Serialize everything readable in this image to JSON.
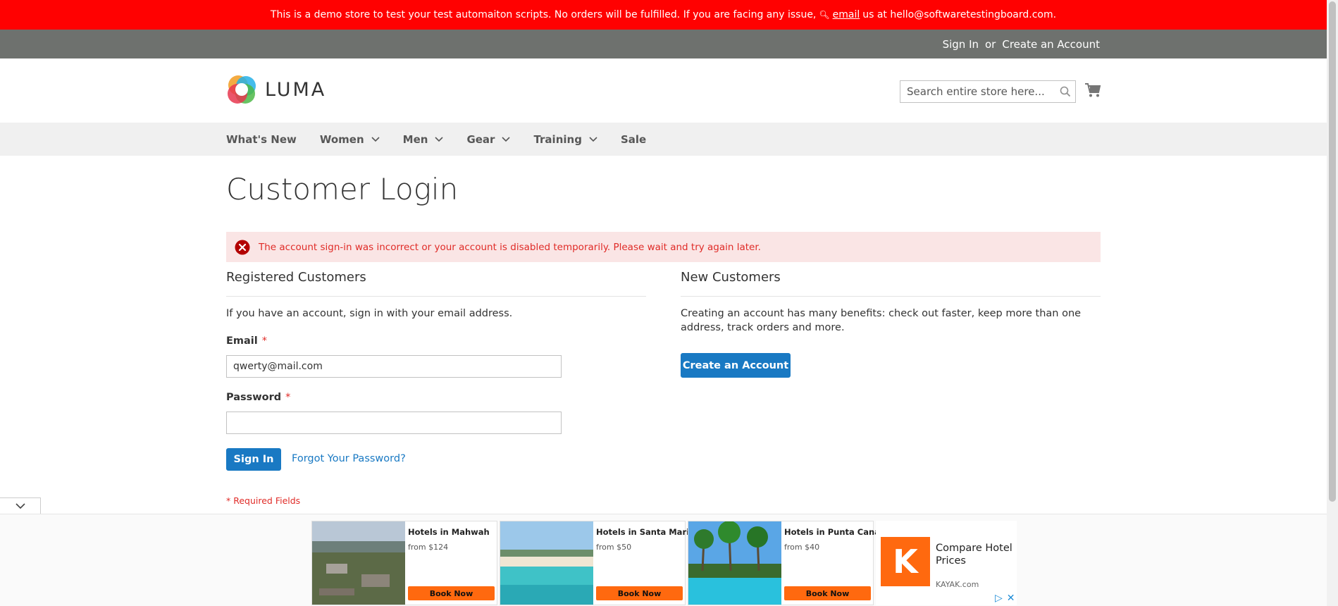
{
  "demo_notice": {
    "text_before": "This is a demo store to test your test automaiton scripts. No orders will be fulfilled. If you are facing any issue,",
    "email_link": "email",
    "text_after": "us at hello@softwaretestingboard.com."
  },
  "header": {
    "sign_in": "Sign In",
    "or": "or",
    "create_account": "Create an Account"
  },
  "logo": {
    "text": "LUMA"
  },
  "search": {
    "placeholder": "Search entire store here..."
  },
  "nav": {
    "items": [
      {
        "label": "What's New",
        "has_dropdown": false
      },
      {
        "label": "Women",
        "has_dropdown": true
      },
      {
        "label": "Men",
        "has_dropdown": true
      },
      {
        "label": "Gear",
        "has_dropdown": true
      },
      {
        "label": "Training",
        "has_dropdown": true
      },
      {
        "label": "Sale",
        "has_dropdown": false
      }
    ]
  },
  "page": {
    "title": "Customer Login"
  },
  "error": {
    "text": "The account sign-in was incorrect or your account is disabled temporarily. Please wait and try again later."
  },
  "registered": {
    "title": "Registered Customers",
    "intro": "If you have an account, sign in with your email address.",
    "email_label": "Email",
    "email_value": "qwerty@mail.com",
    "password_label": "Password",
    "password_value": "",
    "required_mark": "*",
    "sign_in_button": "Sign In",
    "forgot_link": "Forgot Your Password?",
    "required_note": "* Required Fields"
  },
  "new_customers": {
    "title": "New Customers",
    "text": "Creating an account has many benefits: check out faster, keep more than one address, track orders and more.",
    "create_button": "Create an Account"
  },
  "ads": {
    "hotels": [
      {
        "name": "Hotels in Mahwah",
        "price": "from $124",
        "button": "Book Now"
      },
      {
        "name": "Hotels in Santa Maria",
        "price": "from $50",
        "button": "Book Now"
      },
      {
        "name": "Hotels in Punta Cana",
        "price": "from $40",
        "button": "Book Now"
      }
    ],
    "kayak": {
      "letter": "K",
      "title": "Compare Hotel Prices",
      "domain": "KAYAK.com"
    }
  },
  "colors": {
    "demo_bar": "#ff0101",
    "header_panel": "#6e716e",
    "primary": "#1979c3",
    "error_bg": "#fae5e5",
    "error_text": "#e02b27",
    "kayak_orange": "#ff690f"
  }
}
